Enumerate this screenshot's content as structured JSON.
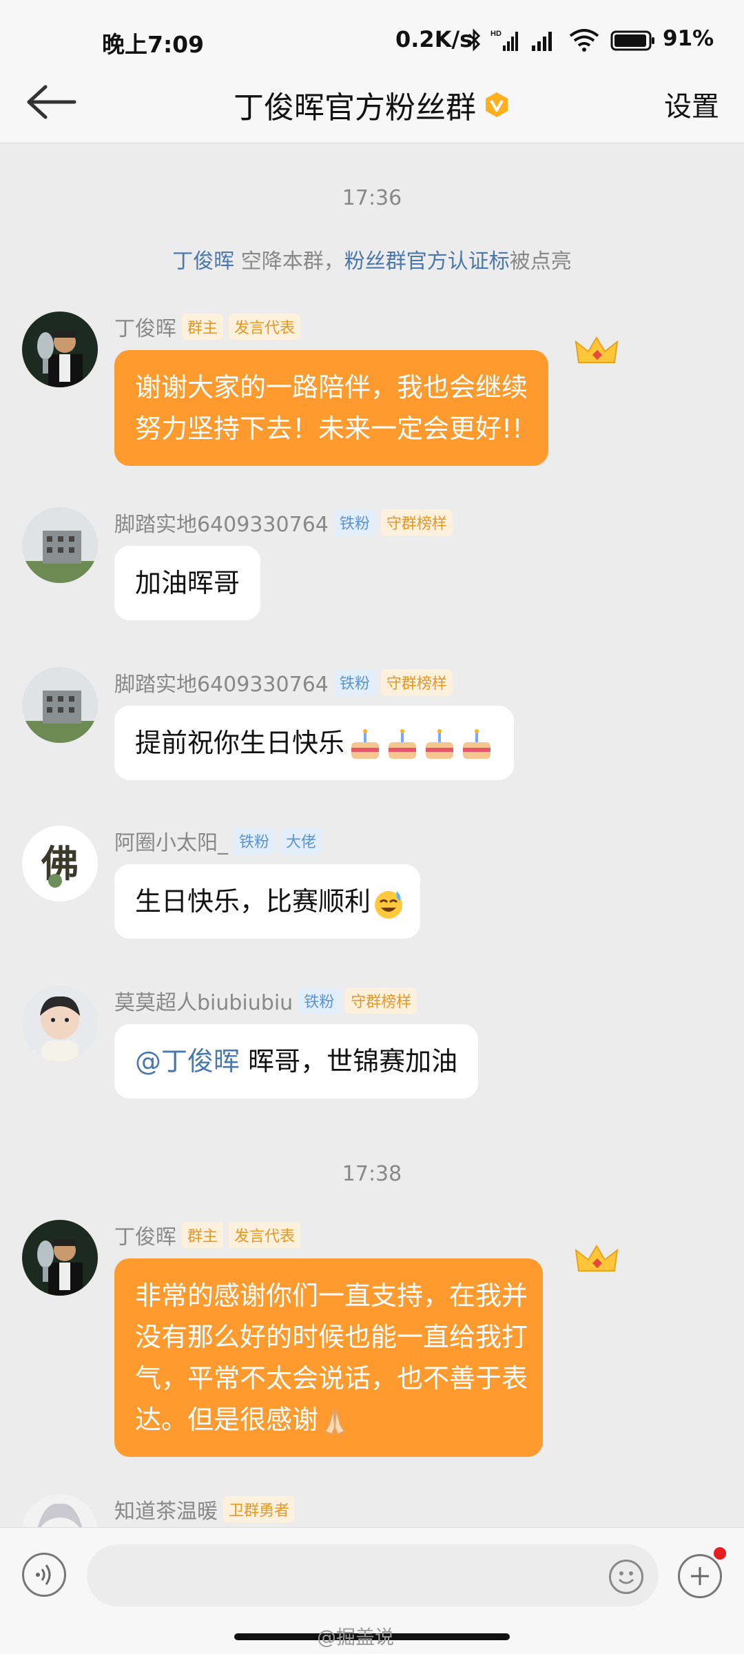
{
  "status_bar": {
    "time": "晚上7:09",
    "speed": "0.2K/s",
    "battery": "91%"
  },
  "header": {
    "title": "丁俊晖官方粉丝群",
    "settings": "设置"
  },
  "chat": {
    "timestamp1": "17:36",
    "system": {
      "name": "丁俊晖",
      "text1": " 空降本群，",
      "highlight": "粉丝群官方认证标",
      "text2": "被点亮"
    },
    "messages": [
      {
        "name": "丁俊晖",
        "tags": [
          "群主",
          "发言代表"
        ],
        "text": "谢谢大家的一路陪伴，我也会继续\n努力坚持下去！未来一定会更好!!"
      },
      {
        "name": "脚踏实地6409330764",
        "tags": [
          "铁粉",
          "守群榜样"
        ],
        "text": "加油晖哥"
      },
      {
        "name": "脚踏实地6409330764",
        "tags": [
          "铁粉",
          "守群榜样"
        ],
        "text": "提前祝你生日快乐"
      },
      {
        "name": "阿圈小太阳_",
        "tags": [
          "铁粉",
          "大佬"
        ],
        "text": "生日快乐，比赛顺利"
      },
      {
        "name": "莫莫超人biubiubiu",
        "tags": [
          "铁粉",
          "守群榜样"
        ],
        "mention": "@丁俊晖",
        "text": " 晖哥，世锦赛加油"
      },
      {
        "name": "丁俊晖",
        "tags": [
          "群主",
          "发言代表"
        ],
        "text": "非常的感谢你们一直支持，在我并\n没有那么好的时候也能一直给我打\n气，平常不太会说话，也不善于表\n达。但是很感谢"
      },
      {
        "name": "知道茶温暖",
        "tags": [
          "卫群勇者"
        ]
      }
    ],
    "timestamp2": "17:38"
  },
  "watermark": "@掘盖说",
  "colors": {
    "accent": "#ff9b2e",
    "link": "#4a78ad"
  }
}
